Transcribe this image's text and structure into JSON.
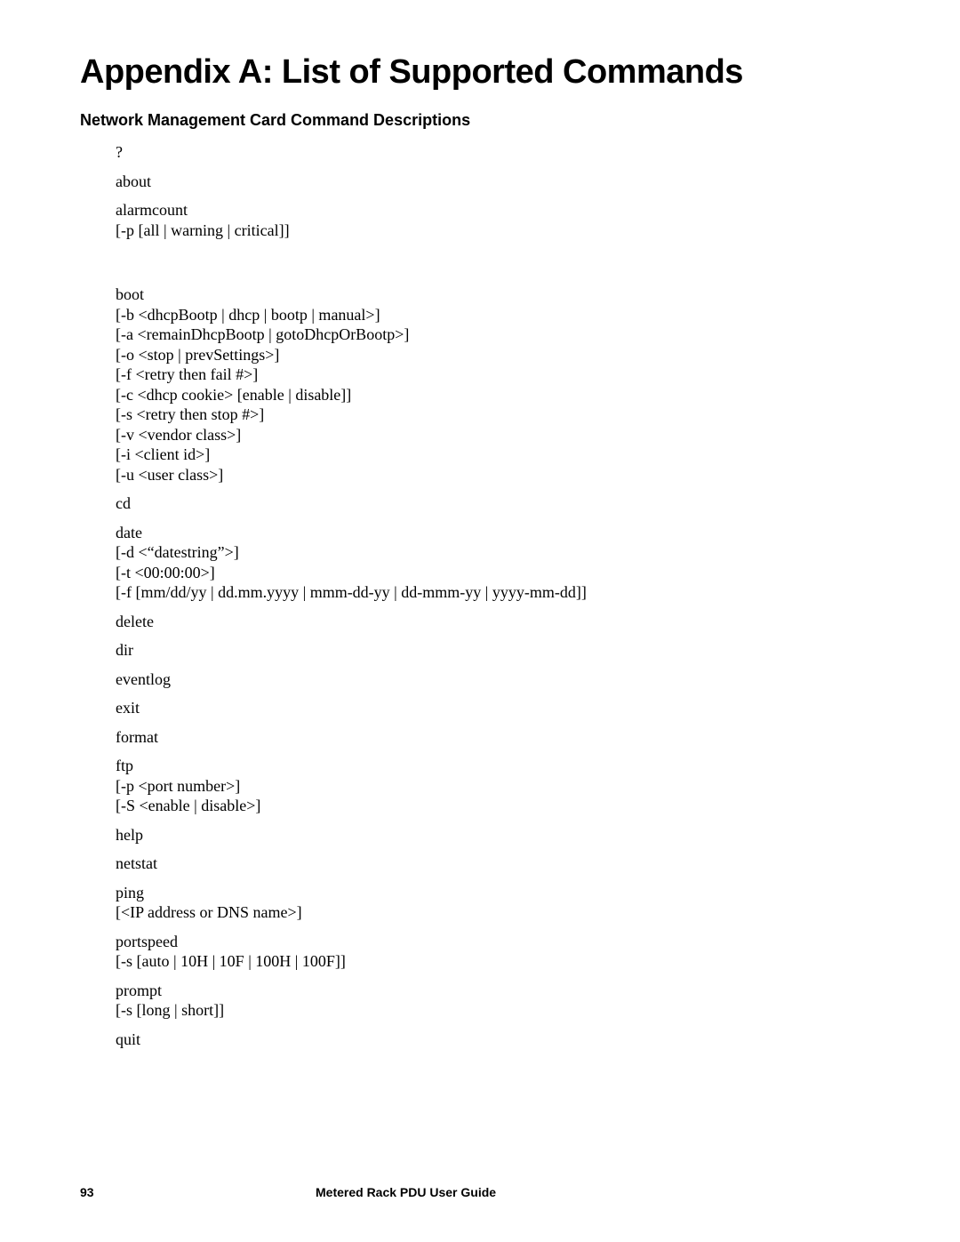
{
  "title": "Appendix A: List of Supported Commands",
  "section": "Network Management Card Command Descriptions",
  "commands": [
    {
      "lines": [
        "?"
      ]
    },
    {
      "lines": [
        "about"
      ]
    },
    {
      "lines": [
        "alarmcount",
        "[-p [all | warning | critical]]"
      ],
      "extraGap": true
    },
    {
      "lines": [
        "boot",
        "[-b <dhcpBootp | dhcp | bootp | manual>]",
        "[-a <remainDhcpBootp | gotoDhcpOrBootp>]",
        "[-o <stop | prevSettings>]",
        "[-f <retry then fail #>]",
        "[-c <dhcp cookie> [enable | disable]]",
        "[-s <retry then stop #>]",
        "[-v <vendor class>]",
        "[-i <client id>]",
        "[-u <user class>]"
      ]
    },
    {
      "lines": [
        "cd"
      ]
    },
    {
      "lines": [
        "date",
        "[-d <“datestring”>]",
        "[-t <00:00:00>]",
        "[-f [mm/dd/yy | dd.mm.yyyy | mmm-dd-yy | dd-mmm-yy | yyyy-mm-dd]]"
      ]
    },
    {
      "lines": [
        "delete"
      ]
    },
    {
      "lines": [
        "dir"
      ]
    },
    {
      "lines": [
        "eventlog"
      ]
    },
    {
      "lines": [
        "exit"
      ]
    },
    {
      "lines": [
        "format"
      ]
    },
    {
      "lines": [
        "ftp",
        "[-p <port number>]",
        "[-S <enable | disable>]"
      ]
    },
    {
      "lines": [
        "help"
      ]
    },
    {
      "lines": [
        "netstat"
      ]
    },
    {
      "lines": [
        "ping",
        "[<IP address or DNS name>]"
      ]
    },
    {
      "lines": [
        "portspeed",
        "[-s [auto | 10H | 10F | 100H | 100F]]"
      ]
    },
    {
      "lines": [
        "prompt",
        "[-s [long | short]]"
      ]
    },
    {
      "lines": [
        "quit"
      ]
    }
  ],
  "footer": {
    "page": "93",
    "doc": "Metered Rack PDU User Guide"
  }
}
